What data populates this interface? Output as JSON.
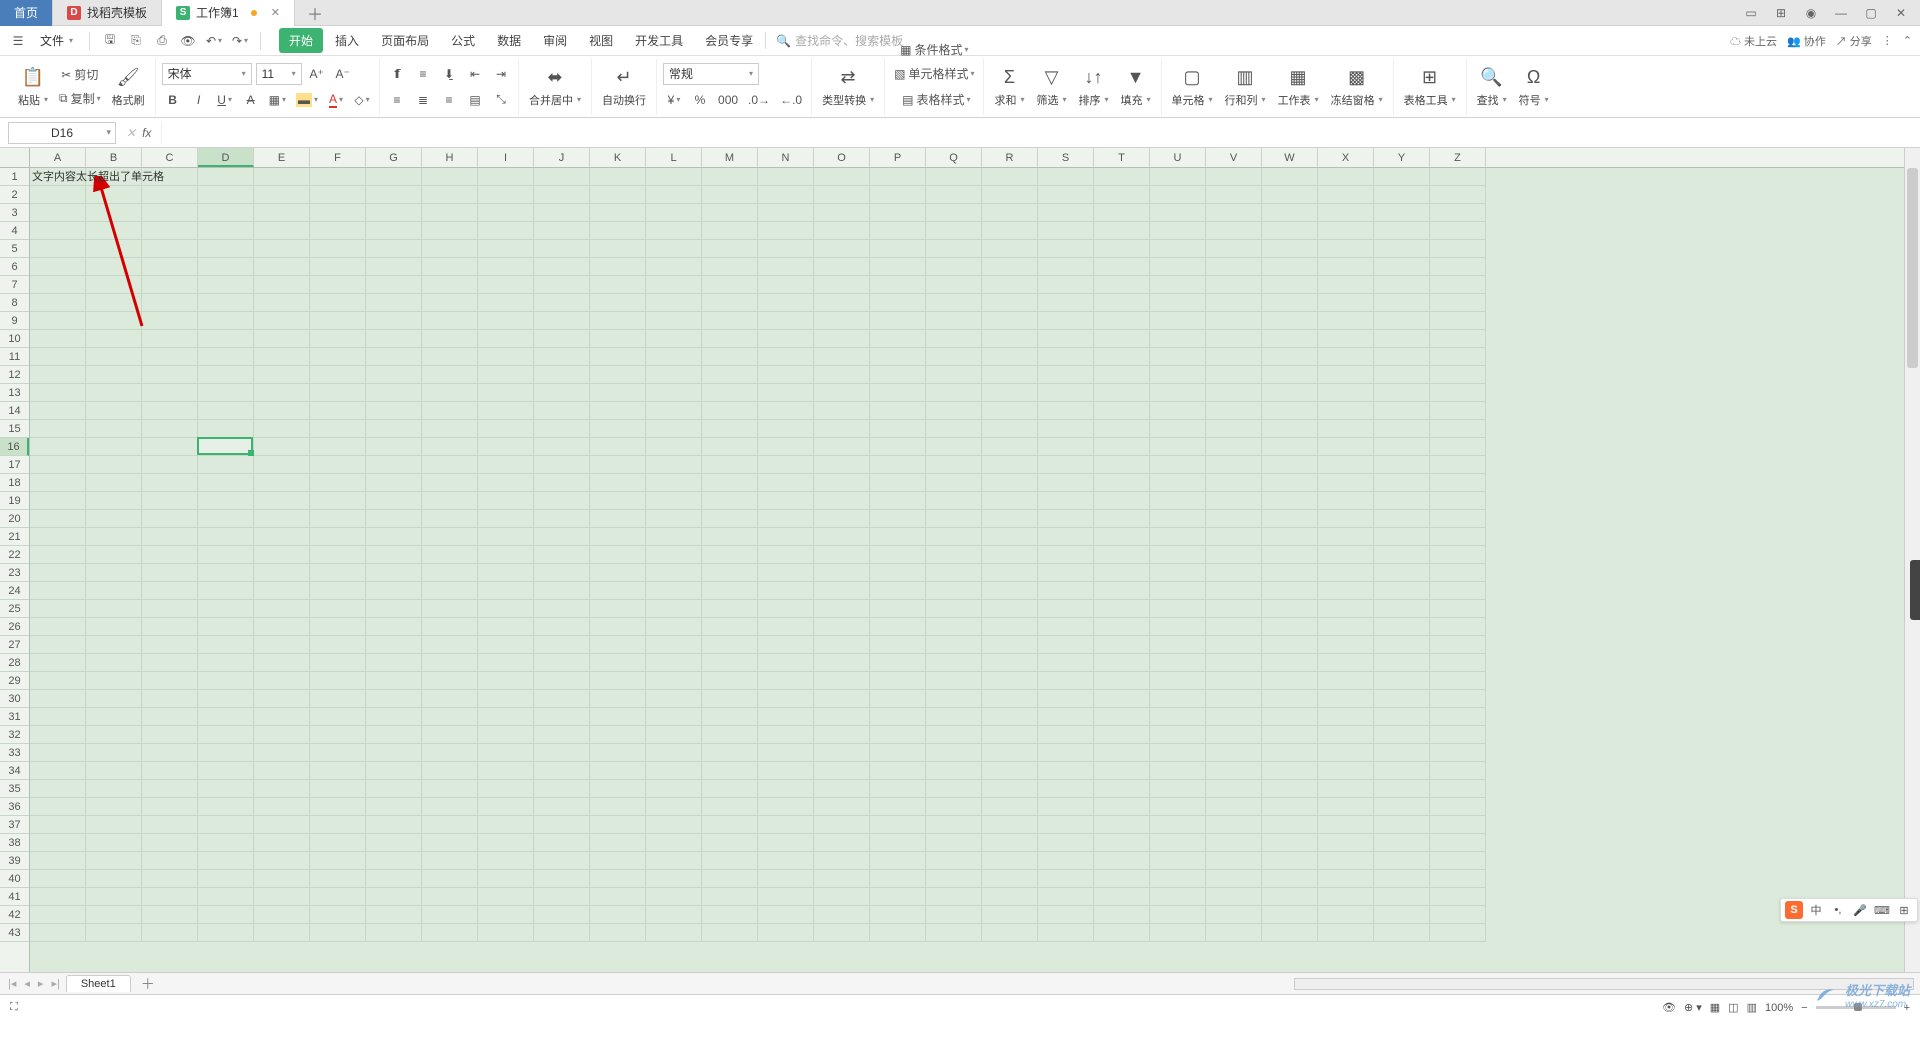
{
  "titleBar": {
    "homeTab": "首页",
    "templateTab": "找稻壳模板",
    "workbookTab": "工作簿1"
  },
  "quickAccess": {
    "fileMenu": "文件"
  },
  "menuTabs": {
    "start": "开始",
    "insert": "插入",
    "pageLayout": "页面布局",
    "formula": "公式",
    "data": "数据",
    "review": "审阅",
    "view": "视图",
    "devTools": "开发工具",
    "member": "会员专享",
    "searchPlaceholder": "查找命令、搜索模板"
  },
  "topRight": {
    "notUploaded": "未上云",
    "collab": "协作",
    "share": "分享"
  },
  "ribbon": {
    "paste": "粘贴",
    "cut": "剪切",
    "copy": "复制",
    "formatPainter": "格式刷",
    "fontName": "宋体",
    "fontSize": "11",
    "mergeCenter": "合并居中",
    "autoWrap": "自动换行",
    "numberFormat": "常规",
    "typeConvert": "类型转换",
    "condFormat": "条件格式",
    "tableStyle": "表格样式",
    "cellStyle": "单元格样式",
    "sum": "求和",
    "filter": "筛选",
    "sort": "排序",
    "fill": "填充",
    "cell": "单元格",
    "rowCol": "行和列",
    "worksheet": "工作表",
    "freezePane": "冻结窗格",
    "tableTools": "表格工具",
    "find": "查找",
    "symbol": "符号"
  },
  "nameBox": {
    "ref": "D16"
  },
  "columns": [
    "A",
    "B",
    "C",
    "D",
    "E",
    "F",
    "G",
    "H",
    "I",
    "J",
    "K",
    "L",
    "M",
    "N",
    "O",
    "P",
    "Q",
    "R",
    "S",
    "T",
    "U",
    "V",
    "W",
    "X",
    "Y",
    "Z"
  ],
  "rowCount": 43,
  "selectedCell": {
    "col": 3,
    "row": 15
  },
  "cellA1": "文字内容太长超出了单元格",
  "sheetBar": {
    "sheet1": "Sheet1"
  },
  "statusBar": {
    "zoom": "100%",
    "watermarkText": "极光下载站",
    "watermarkUrl": "www.xz7.com"
  },
  "ime": {
    "lang": "中"
  }
}
